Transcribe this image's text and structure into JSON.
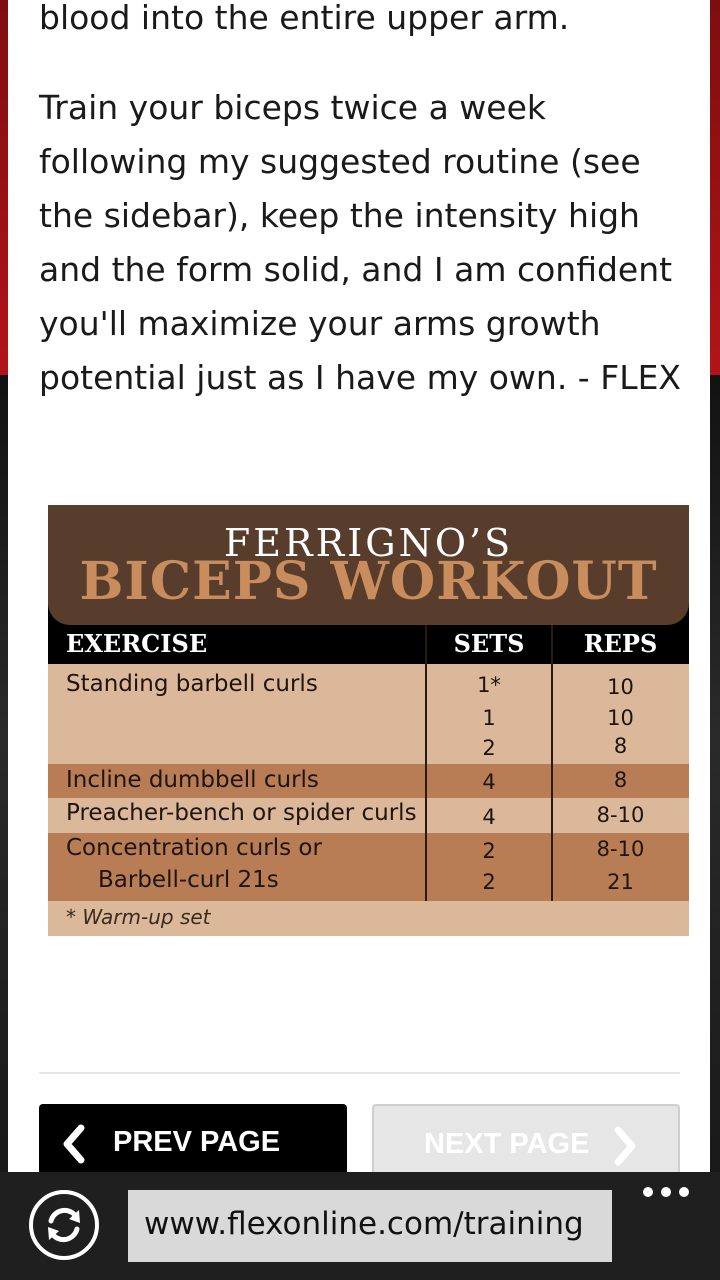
{
  "article": {
    "paragraph_top": "blood into the entire upper arm.",
    "paragraph_main": "Train your biceps twice a week following my suggested routine (see the sidebar), keep the intensity high and the form solid, and I am confident you'll maximize your arms growth potential just as I have my own. - FLEX"
  },
  "workout_table": {
    "title_line1": "FERRIGNO’S",
    "title_line2": "BICEPS WORKOUT",
    "headers": {
      "exercise": "EXERCISE",
      "sets": "SETS",
      "reps": "REPS"
    },
    "rows": [
      {
        "exercise": "Standing barbell curls",
        "sets": "1*",
        "reps": "10"
      },
      {
        "exercise": "",
        "sets": "1",
        "reps": "10"
      },
      {
        "exercise": "",
        "sets": "2",
        "reps": "8"
      },
      {
        "exercise": "Incline dumbbell curls",
        "sets": "4",
        "reps": "8"
      },
      {
        "exercise": "Preacher-bench or spider curls",
        "sets": "4",
        "reps": "8-10"
      },
      {
        "exercise": "Concentration curls or",
        "sets": "2",
        "reps": "8-10"
      },
      {
        "exercise": "Barbell-curl 21s",
        "sets": "2",
        "reps": "21"
      }
    ],
    "footnote": "* Warm-up set"
  },
  "navigation": {
    "prev_label": "PREV PAGE",
    "next_label": "NEXT PAGE"
  },
  "browser": {
    "url": "www.flexonline.com/training"
  },
  "colors": {
    "accent_red": "#b11418",
    "table_header_brown": "#593d2c",
    "title_orange": "#c98c5c",
    "row_light": "#dcb89b",
    "row_dark": "#b97d55"
  },
  "icons": {
    "refresh": "refresh-icon",
    "more": "more-dots-icon",
    "prev": "chevron-left-icon",
    "next": "chevron-right-icon"
  }
}
